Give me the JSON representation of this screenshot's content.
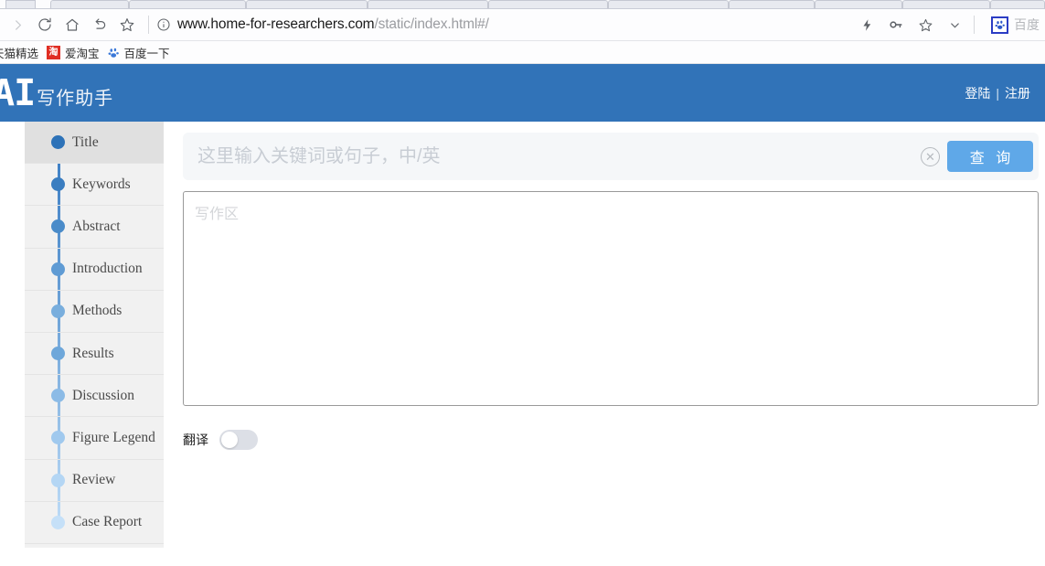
{
  "browser": {
    "tabs": [
      {
        "name": "tab-1"
      },
      {
        "name": "tab-2"
      },
      {
        "name": "tab-3"
      },
      {
        "name": "tab-4"
      },
      {
        "name": "tab-5"
      },
      {
        "name": "tab-6"
      },
      {
        "name": "tab-7"
      },
      {
        "name": "tab-8"
      },
      {
        "name": "tab-9"
      },
      {
        "name": "tab-10"
      }
    ],
    "toolbar": {
      "forward_icon": "forward-arrow-icon",
      "reload_icon": "reload-icon",
      "home_icon": "home-icon",
      "back_icon": "undo-arrow-icon",
      "bookmark_icon": "star-icon",
      "info_icon": "info-circle-icon",
      "lightning_icon": "lightning-icon",
      "key_icon": "key-icon",
      "star_icon": "star-icon",
      "chevron_icon": "chevron-down-icon",
      "extension_icon": "baidu-paw-icon",
      "extension_label": "百度"
    },
    "url": {
      "domain": "www.home-for-researchers.com",
      "path": "/static/index.html#/"
    },
    "bookmarks": [
      {
        "label": "天猫精选",
        "icon": "tmall-icon"
      },
      {
        "label": "爱淘宝",
        "icon": "taobao-icon",
        "icon_text": "淘"
      },
      {
        "label": "百度一下",
        "icon": "baidu-paw-icon"
      }
    ]
  },
  "header": {
    "logo_mark": "AI",
    "logo_text": "写作助手",
    "login_label": "登陆",
    "divider": "|",
    "register_label": "注册",
    "brand_color": "#3173b8"
  },
  "sidebar": {
    "items": [
      {
        "label": "Title",
        "active": true,
        "dot_color": "#2d72b8"
      },
      {
        "label": "Keywords",
        "active": false,
        "dot_color": "#3a7dc0"
      },
      {
        "label": "Abstract",
        "active": false,
        "dot_color": "#4a8bc9"
      },
      {
        "label": "Introduction",
        "active": false,
        "dot_color": "#5f9bd4"
      },
      {
        "label": "Methods",
        "active": false,
        "dot_color": "#79aedd"
      },
      {
        "label": "Results",
        "active": false,
        "dot_color": "#6ea7da"
      },
      {
        "label": "Discussion",
        "active": false,
        "dot_color": "#8cbbe6"
      },
      {
        "label": "Figure Legend",
        "active": false,
        "dot_color": "#a0c9ee"
      },
      {
        "label": "Review",
        "active": false,
        "dot_color": "#b4d6f4"
      },
      {
        "label": "Case Report",
        "active": false,
        "dot_color": "#c5e0f8"
      }
    ]
  },
  "main": {
    "search": {
      "value": "",
      "placeholder": "这里输入关键词或句子，中/英",
      "clear_icon": "clear-circle-icon",
      "button_label": "查 询",
      "button_color": "#5fa8e8"
    },
    "editor": {
      "value": "",
      "placeholder": "写作区"
    },
    "translate": {
      "label": "翻译",
      "state": "off"
    }
  }
}
